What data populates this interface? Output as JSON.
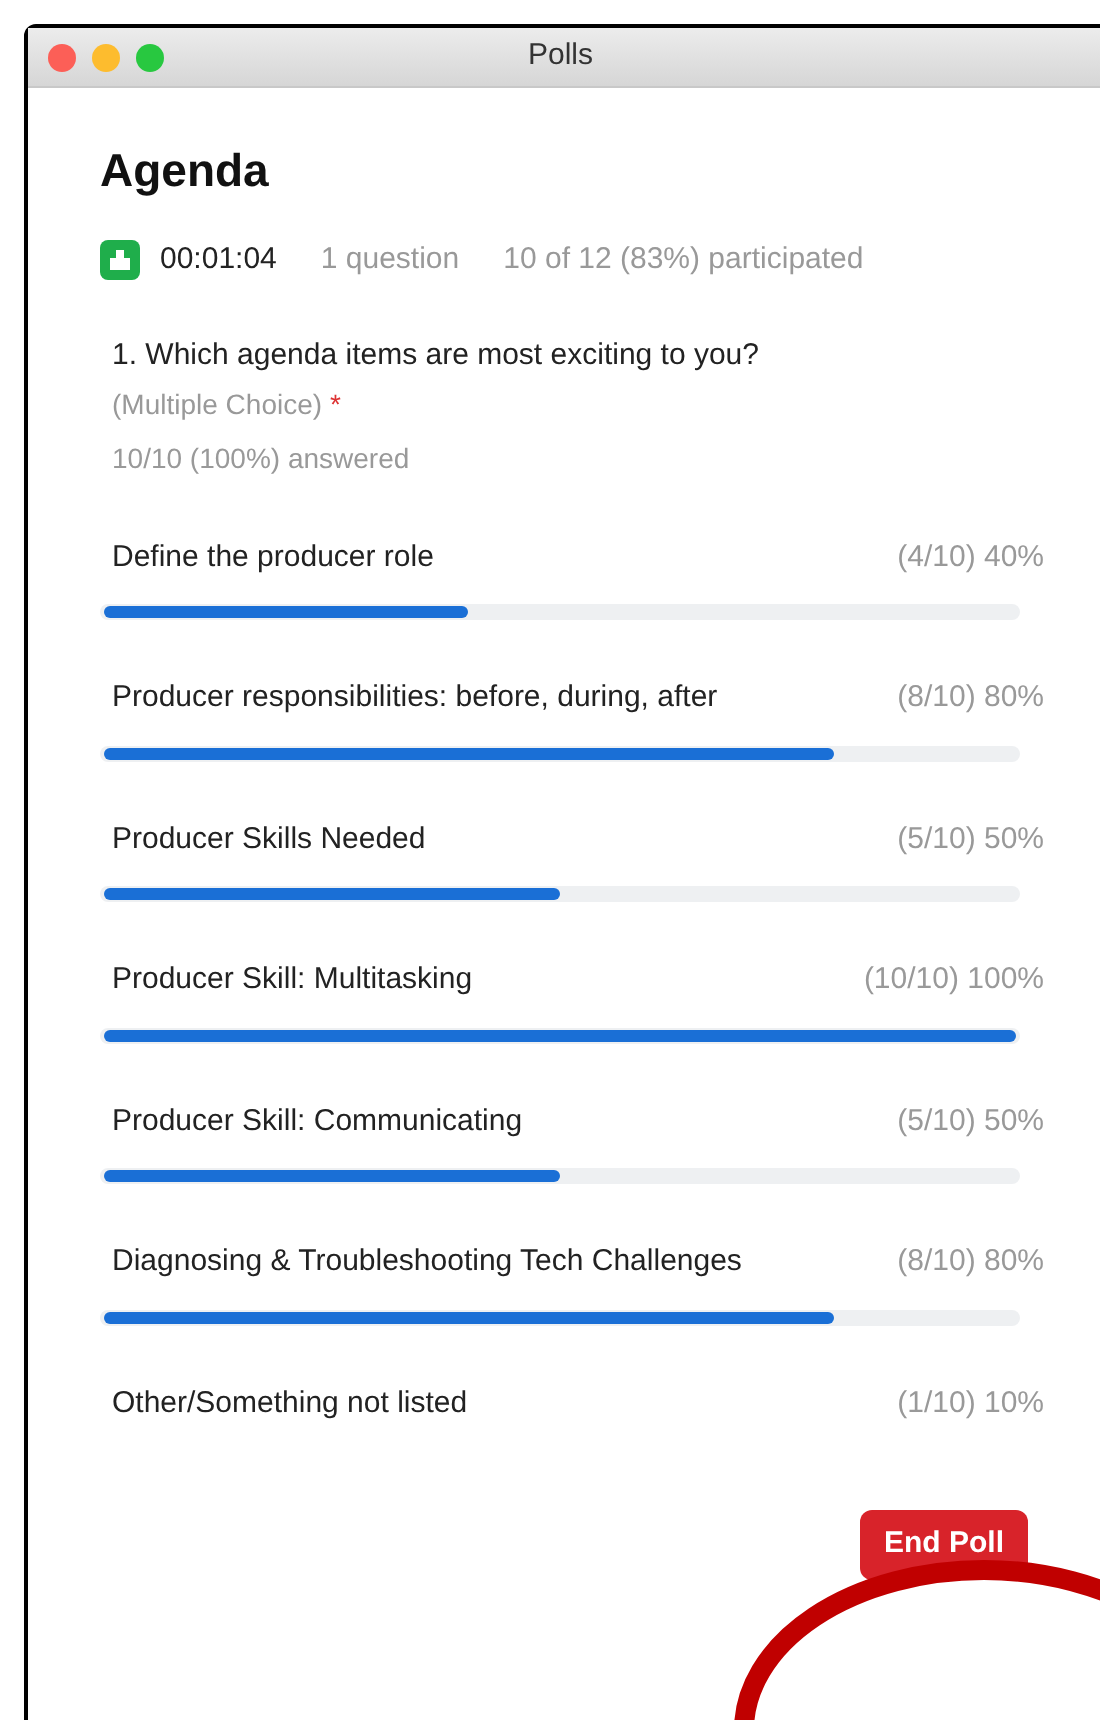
{
  "window": {
    "title": "Polls"
  },
  "poll": {
    "title": "Agenda",
    "timer": "00:01:04",
    "questions": "1 question",
    "participation": "10 of 12 (83%) participated"
  },
  "question": {
    "text": "1. Which agenda items are most exciting to you?",
    "type": "(Multiple Choice)",
    "required_mark": "*",
    "answered": "10/10 (100%) answered"
  },
  "options": [
    {
      "label": "Define the producer role",
      "result": "(4/10) 40%",
      "level": 0.4
    },
    {
      "label": "Producer responsibilities: before, during, after",
      "result": "(8/10) 80%",
      "level": 0.8
    },
    {
      "label": "Producer Skills Needed",
      "result": "(5/10) 50%",
      "level": 0.5
    },
    {
      "label": "Producer Skill: Multitasking",
      "result": "(10/10) 100%",
      "level": 1
    },
    {
      "label": "Producer Skill: Communicating",
      "result": "(5/10) 50%",
      "level": 0.5
    },
    {
      "label": "Diagnosing & Troubleshooting Tech Challenges",
      "result": "(8/10) 80%",
      "level": 0.8
    },
    {
      "label": "Other/Something not listed",
      "result": "(1/10) 10%"
    }
  ],
  "end_button": {
    "label": "End Poll"
  }
}
